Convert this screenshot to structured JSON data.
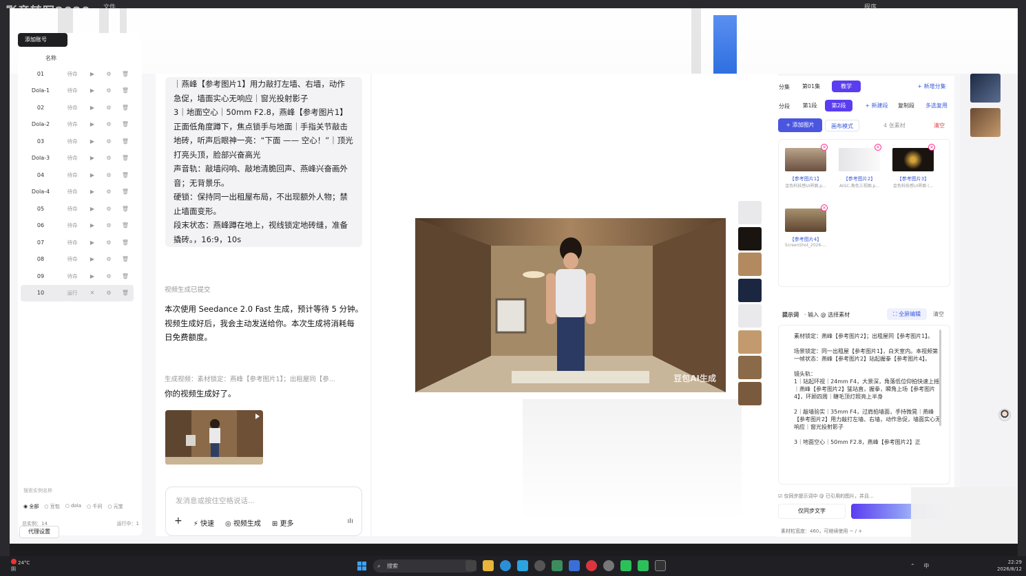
{
  "desktop": {
    "app_title": "影音转写2020",
    "menu_label": "文件",
    "right_label": "程序"
  },
  "sidebar": {
    "add_button": "添加账号",
    "column_header": "名称",
    "rows": [
      {
        "name": "01",
        "status": "待命"
      },
      {
        "name": "Dola-1",
        "status": "待命"
      },
      {
        "name": "02",
        "status": "待命"
      },
      {
        "name": "Dola-2",
        "status": "待命"
      },
      {
        "name": "03",
        "status": "待命"
      },
      {
        "name": "Dola-3",
        "status": "待命"
      },
      {
        "name": "04",
        "status": "待命"
      },
      {
        "name": "Dola-4",
        "status": "待命"
      },
      {
        "name": "05",
        "status": "待命"
      },
      {
        "name": "06",
        "status": "待命"
      },
      {
        "name": "07",
        "status": "待命"
      },
      {
        "name": "08",
        "status": "待命"
      },
      {
        "name": "09",
        "status": "待命"
      },
      {
        "name": "10",
        "status": "运行"
      }
    ],
    "search_placeholder": "搜索实例名称",
    "filters": [
      "全部",
      "豆包",
      "dola",
      "千问",
      "元宝"
    ],
    "total_label": "总实例：14",
    "running_label": "运行中：1",
    "proxy_button": "代理设置"
  },
  "chat": {
    "bubble_lines": [
      "｜燕峰【参考图片1】用力敲打左墙、右墙，动作",
      "急促，墙面实心无响应｜窗光投射影子",
      "3｜地面空心｜50mm F2.8，燕峰【参考图片1】",
      "正面低角度蹲下，焦点锁手与地面｜手指关节敲击",
      "地砖，听声后眼神一亮：“下面 —— 空心！”｜顶光",
      "打亮头顶，脸部兴奋高光",
      "声音轨：敲墙闷响、敲地清脆回声、燕峰兴奋画外",
      "音；无背景乐。",
      "硬锁：保持同一出租屋布局，不出现额外人物；禁",
      "止墙面变形。",
      "段末状态：燕峰蹲在地上，视线锁定地砖缝，准备",
      "撬砖。，16:9，10s"
    ],
    "submitted_note": "视频生成已提交",
    "msg_lines": [
      "本次使用 Seedance 2.0 Fast 生成，预计等待 5 分钟。",
      "视频生成好后，我会主动发送给你。本次生成将消耗每",
      "日免费额度。"
    ],
    "quote": "生成视频：素材锁定：燕峰【参考图片1】；出租屋同【参...",
    "done": "你的视频生成好了。",
    "input_placeholder": "发消息或按住空格说话...",
    "tools": [
      "快速",
      "视频生成",
      "更多"
    ],
    "add_icon": "+"
  },
  "preview": {
    "watermark": "豆包AI生成"
  },
  "right_panel": {
    "episode_label": "分集",
    "episode": "第01集",
    "episode_active": "教学",
    "new_episode": "+ 新增分集",
    "segment_label": "分段",
    "segment1": "第1段",
    "segment2": "第2段",
    "new_segment": "+ 新建段",
    "copy_segment": "复制段",
    "multi_select": "多选复用",
    "add_image": "+ 添加图片",
    "canvas_mode": "画布模式",
    "material_count": "4 张素材",
    "clear": "清空",
    "materials": [
      {
        "title": "【参考图片1】",
        "sub": "金色科技感UI界面.p..."
      },
      {
        "title": "【参考图片2】",
        "sub": "AIGC-角色三视图.p..."
      },
      {
        "title": "【参考图片3】",
        "sub": "金色科技感UI界面 (..."
      },
      {
        "title": "【参考图片4】",
        "sub": "ScreenShot_2026-..."
      }
    ],
    "prompt_label": "提示词",
    "prompt_hint": "· 输入 @ 选择素材",
    "fullscreen_edit": "⛶ 全屏编辑",
    "prompt_clear": "清空",
    "prompt_text": "素材锁定：燕峰【参考图片2】；出租屋同【参考图片1】。\n\n场景锁定：同一出租屋【参考图片1】，白天室内。本视频第一帧状态：燕峰【参考图片2】站起握拳【参考图片4】。\n\n镜头轨：\n1｜站起环视｜24mm F4，大景深，角落低位仰拍快速上摇｜燕峰【参考图片2】猛站直，握拳，瞬角上场【参考图片4】，环顾四周｜睫毛顶灯照亮上半身\n\n2｜敲墙验实｜35mm F4，过肩拍墙面，手持微晃｜燕峰【参考图片2】用力敲打左墙、右墙，动作急促，墙面实心无响应｜窗光投射影子\n\n3｜地面空心｜50mm F2.8，燕峰【参考图片2】正",
    "check_label": "仅同步提示词中 @ 已引用的图片，并且...",
    "sync_button": "仅同步文字",
    "footer": "素材粒宽度：460，可继续使用 ~ / +"
  },
  "taskbar": {
    "weather_temp": "24°C",
    "weather_desc": "阴",
    "search_label": "搜索",
    "tray": "⌃ 中",
    "time": "22:29",
    "date": "2026/8/12"
  }
}
